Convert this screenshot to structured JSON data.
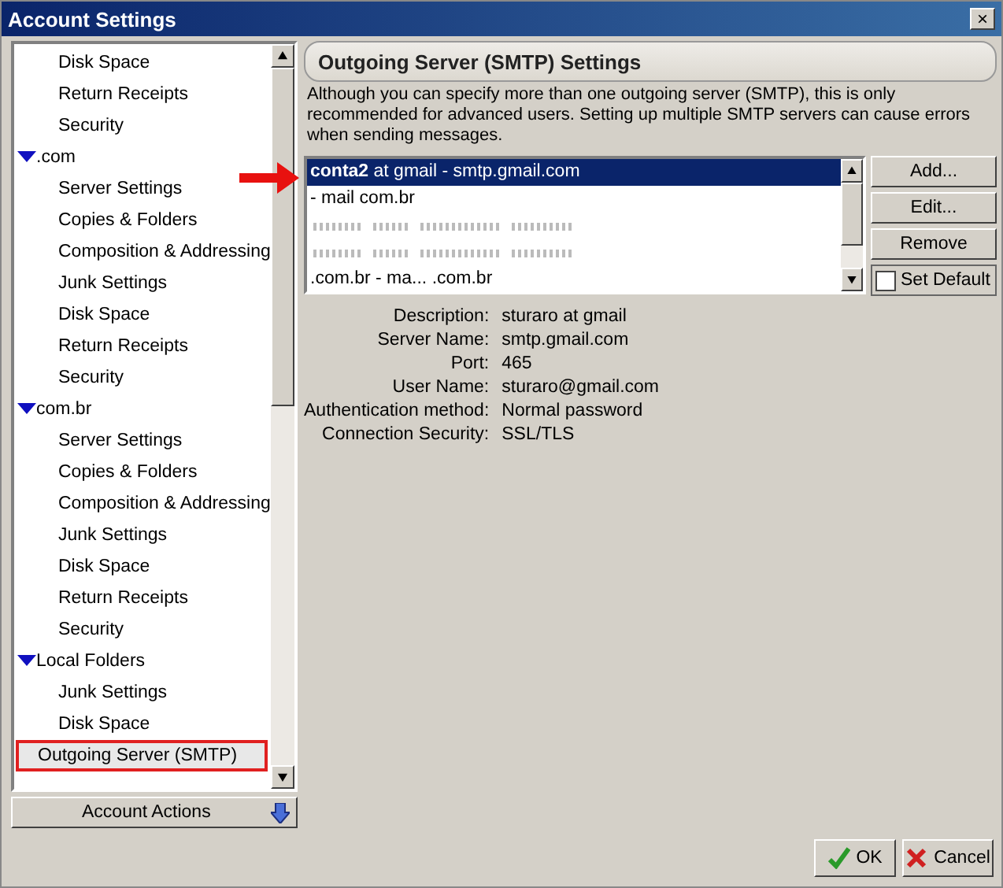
{
  "window": {
    "title": "Account Settings",
    "close": "×"
  },
  "tree": {
    "leading_children": [
      {
        "label": "Disk Space",
        "selected": false
      },
      {
        "label": "Return Receipts",
        "selected": false
      },
      {
        "label": "Security",
        "selected": false
      }
    ],
    "items": [
      {
        "label": ".com",
        "expanded": true,
        "children": [
          {
            "label": "Server Settings",
            "selected": false
          },
          {
            "label": "Copies & Folders",
            "selected": false
          },
          {
            "label": "Composition & Addressing",
            "selected": false
          },
          {
            "label": "Junk Settings",
            "selected": false
          },
          {
            "label": "Disk Space",
            "selected": false
          },
          {
            "label": "Return Receipts",
            "selected": false
          },
          {
            "label": "Security",
            "selected": false
          }
        ]
      },
      {
        "label": "com.br",
        "expanded": true,
        "children": [
          {
            "label": "Server Settings",
            "selected": false
          },
          {
            "label": "Copies & Folders",
            "selected": false
          },
          {
            "label": "Composition & Addressing",
            "selected": false
          },
          {
            "label": "Junk Settings",
            "selected": false
          },
          {
            "label": "Disk Space",
            "selected": false
          },
          {
            "label": "Return Receipts",
            "selected": false
          },
          {
            "label": "Security",
            "selected": false
          }
        ]
      },
      {
        "label": "Local Folders",
        "expanded": true,
        "children": [
          {
            "label": "Junk Settings",
            "selected": false
          },
          {
            "label": "Disk Space",
            "selected": false
          }
        ]
      },
      {
        "label": "Outgoing Server (SMTP)",
        "selected": true
      }
    ]
  },
  "account_actions": {
    "label": "Account Actions"
  },
  "panel": {
    "title": "Outgoing Server (SMTP) Settings",
    "description": "Although you can specify more than one outgoing server (SMTP), this is only recommended for advanced users. Setting up multiple SMTP servers can cause errors when sending messages.",
    "servers": [
      {
        "kind": "text",
        "text": "**conta2** at gmail - smtp.gmail.com",
        "selected": true
      },
      {
        "kind": "text",
        "text": "- mail com.br",
        "selected": false
      },
      {
        "kind": "obscured",
        "selected": false
      },
      {
        "kind": "obscured",
        "selected": false
      },
      {
        "kind": "text",
        "text": ".com.br - ma... .com.br",
        "selected": false
      }
    ],
    "buttons": [
      "Add...",
      "Edit...",
      "Remove"
    ],
    "set_default": {
      "label": "Set Default",
      "checked": false
    },
    "details": [
      {
        "label": "Description:",
        "value": "sturaro at gmail"
      },
      {
        "label": "Server Name:",
        "value": "smtp.gmail.com"
      },
      {
        "label": "Port:",
        "value": "465"
      },
      {
        "label": "User Name:",
        "value": "sturaro@gmail.com"
      },
      {
        "label": "Authentication method:",
        "value": "Normal password"
      },
      {
        "label": "Connection Security:",
        "value": "SSL/TLS"
      }
    ]
  },
  "dialog_buttons": [
    {
      "kind": "ok",
      "label": "OK"
    },
    {
      "kind": "cancel",
      "label": "Cancel"
    }
  ]
}
